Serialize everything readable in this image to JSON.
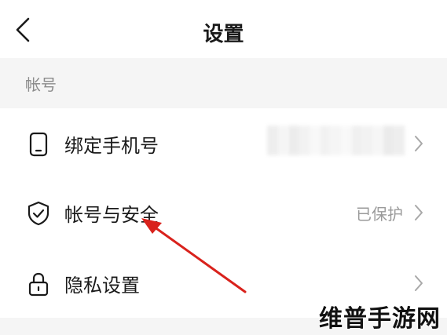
{
  "header": {
    "title": "设置",
    "back_icon": "chevron-left-icon"
  },
  "section": {
    "label": "帐号"
  },
  "rows": [
    {
      "label": "绑定手机号",
      "icon": "phone-icon",
      "value": "",
      "value_obscured": true,
      "chevron_icon": "chevron-right-icon"
    },
    {
      "label": "帐号与安全",
      "icon": "shield-check-icon",
      "status": "已保护",
      "chevron_icon": "chevron-right-icon"
    },
    {
      "label": "隐私设置",
      "icon": "lock-icon",
      "chevron_icon": "chevron-right-icon"
    }
  ],
  "annotation": {
    "type": "arrow",
    "color": "#d9221c",
    "points_to": "帐号与安全"
  },
  "watermark": {
    "text": "维普手游网"
  },
  "colors": {
    "background": "#ffffff",
    "section_band": "#f5f5f5",
    "primary_text": "#1a1a1a",
    "secondary_text": "#9a9a9a"
  }
}
